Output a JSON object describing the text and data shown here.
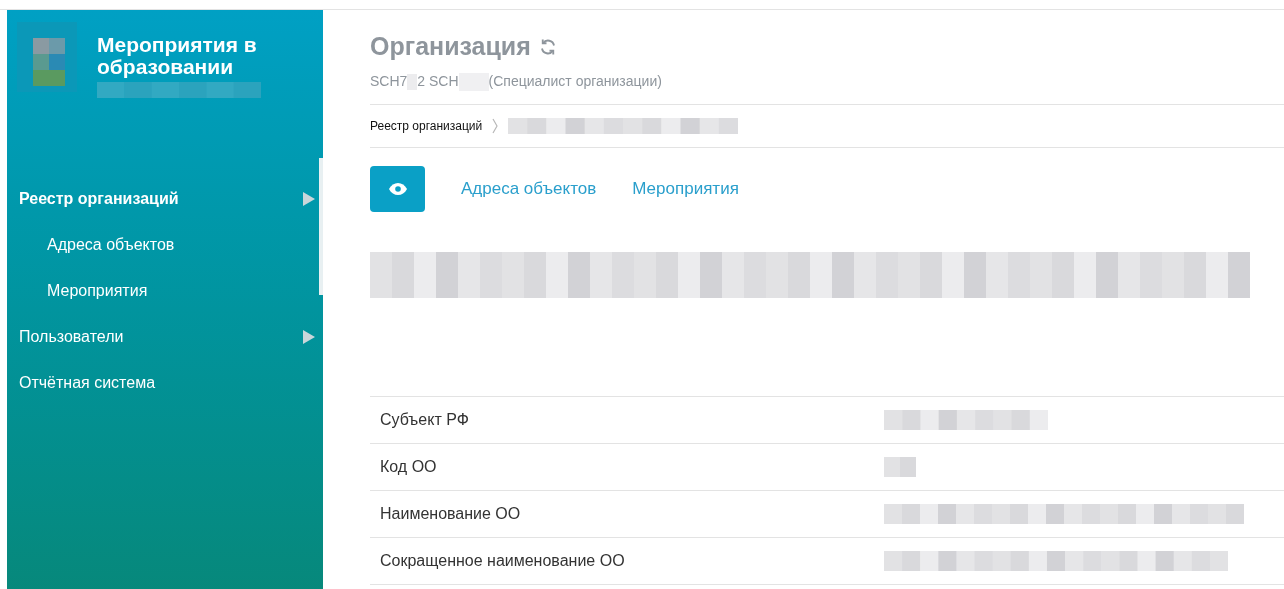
{
  "app": {
    "title": "Мероприятия в образовании"
  },
  "sidebar": {
    "items": [
      {
        "label": "Реестр организаций",
        "selected": true,
        "expandable": true,
        "children": [
          {
            "label": "Адреса объектов",
            "selected": false
          },
          {
            "label": "Мероприятия",
            "selected": false
          }
        ]
      },
      {
        "label": "Пользователи",
        "selected": false,
        "expandable": true
      },
      {
        "label": "Отчётная система",
        "selected": false,
        "expandable": false
      }
    ]
  },
  "header": {
    "title": "Организация",
    "user": {
      "name_start": "SCH7",
      "name_middle": "2 SCH",
      "role": "(Специалист организации)"
    }
  },
  "breadcrumb": [
    "Реестр организаций"
  ],
  "tabs": [
    {
      "kind": "icon",
      "selected": true
    },
    {
      "kind": "link",
      "label": "Адреса объектов",
      "selected": false
    },
    {
      "kind": "link",
      "label": "Мероприятия",
      "selected": false
    }
  ],
  "fields": [
    {
      "label": "Субъект РФ"
    },
    {
      "label": "Код ОО"
    },
    {
      "label": "Наименование ОО"
    },
    {
      "label": "Сокращенное наименование ОО"
    }
  ]
}
